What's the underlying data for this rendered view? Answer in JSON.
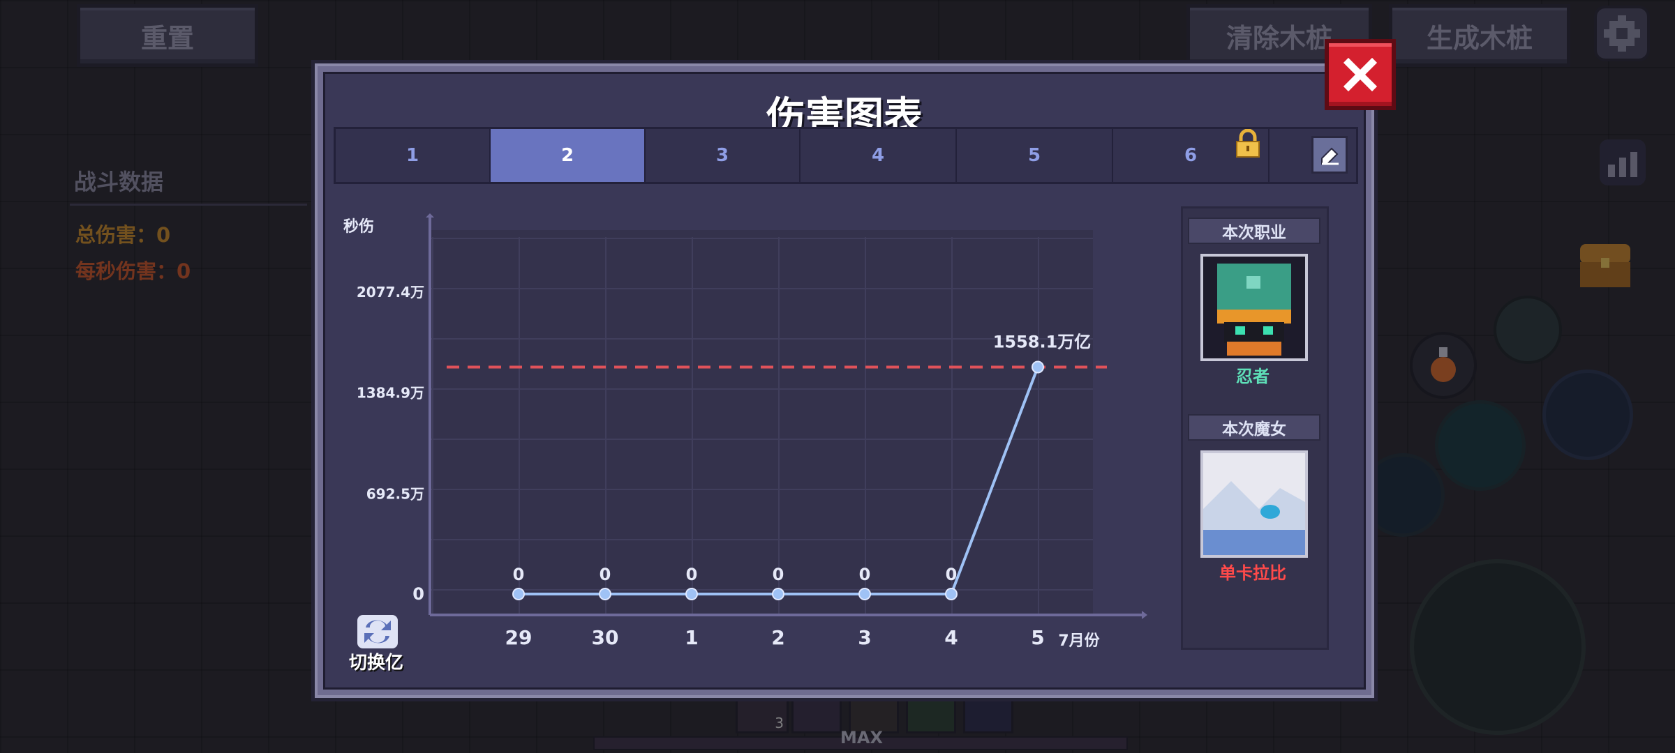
{
  "top_buttons": {
    "reset": "重置",
    "clear_dummy": "清除木桩",
    "spawn_dummy": "生成木桩"
  },
  "left_panel": {
    "title": "战斗数据",
    "total_damage": "总伤害：0",
    "dps": "每秒伤害：0"
  },
  "bottom_hud": {
    "max_label": "MAX",
    "item_count": "3"
  },
  "modal": {
    "title": "伤害图表",
    "tabs": [
      {
        "label": "1",
        "active": false
      },
      {
        "label": "2",
        "active": true
      },
      {
        "label": "3",
        "active": false
      },
      {
        "label": "4",
        "active": false
      },
      {
        "label": "5",
        "active": false
      },
      {
        "label": "6",
        "active": false,
        "locked": true
      }
    ],
    "switch_label": "切换亿",
    "class_header": "本次职业",
    "class_name": "忍者",
    "witch_header": "本次魔女",
    "witch_name": "单卡拉比",
    "colors": {
      "class_name": "#5ee0b8",
      "witch_name": "#ff4a4a",
      "line": "#9fc2f5",
      "threshold": "#e0525a"
    }
  },
  "chart_data": {
    "type": "line",
    "ylabel": "秒伤",
    "xlabel": "7月份",
    "categories": [
      "29",
      "30",
      "1",
      "2",
      "3",
      "4",
      "5"
    ],
    "y_ticks": [
      {
        "value": 0,
        "label": "0"
      },
      {
        "value": 692.5,
        "label": "692.5万"
      },
      {
        "value": 1384.9,
        "label": "1384.9万"
      },
      {
        "value": 2077.4,
        "label": "2077.4万"
      }
    ],
    "ylim": [
      0,
      2077.4
    ],
    "series": [
      {
        "values": [
          0,
          0,
          0,
          0,
          0,
          0,
          1558.1
        ],
        "data_labels": [
          "0",
          "0",
          "0",
          "0",
          "0",
          "0",
          "1558.1万亿"
        ]
      }
    ],
    "reference_line": 1558.1,
    "grid": true
  }
}
